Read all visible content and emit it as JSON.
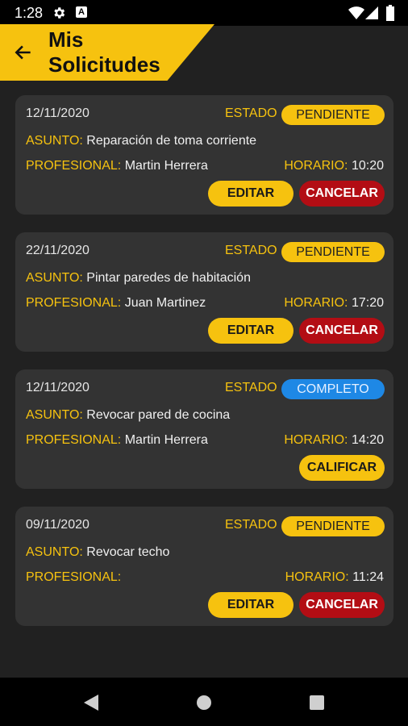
{
  "status_bar": {
    "time": "1:28",
    "a_badge": "A"
  },
  "header": {
    "title": "Mis Solicitudes",
    "back_icon": "arrow-left-icon"
  },
  "labels": {
    "estado": "ESTADO",
    "asunto": "ASUNTO:",
    "profesional": "PROFESIONAL:",
    "horario": "HORARIO:"
  },
  "colors": {
    "accent": "#f6c20f",
    "cancel": "#b30d14",
    "complete": "#1e88e5",
    "card": "#333333",
    "background": "#212121"
  },
  "requests": [
    {
      "date": "12/11/2020",
      "status": "PENDIENTE",
      "status_type": "pendiente",
      "asunto": "Reparación de toma corriente",
      "profesional": "Martin Herrera",
      "horario": "10:20",
      "buttons": {
        "edit": "EDITAR",
        "cancel": "CANCELAR"
      }
    },
    {
      "date": "22/11/2020",
      "status": "PENDIENTE",
      "status_type": "pendiente",
      "asunto": "Pintar paredes de habitación",
      "profesional": "Juan Martinez",
      "horario": "17:20",
      "buttons": {
        "edit": "EDITAR",
        "cancel": "CANCELAR"
      }
    },
    {
      "date": "12/11/2020",
      "status": "COMPLETO",
      "status_type": "completo",
      "asunto": "Revocar pared de cocina",
      "profesional": "Martin Herrera",
      "horario": "14:20",
      "buttons": {
        "rate": "CALIFICAR"
      }
    },
    {
      "date": "09/11/2020",
      "status": "PENDIENTE",
      "status_type": "pendiente",
      "asunto": "Revocar techo",
      "profesional": "",
      "horario": "11:24",
      "buttons": {
        "edit": "EDITAR",
        "cancel": "CANCELAR"
      }
    }
  ],
  "nav": {
    "back_icon": "triangle-back-icon",
    "home_icon": "circle-home-icon",
    "recents_icon": "square-recents-icon"
  }
}
